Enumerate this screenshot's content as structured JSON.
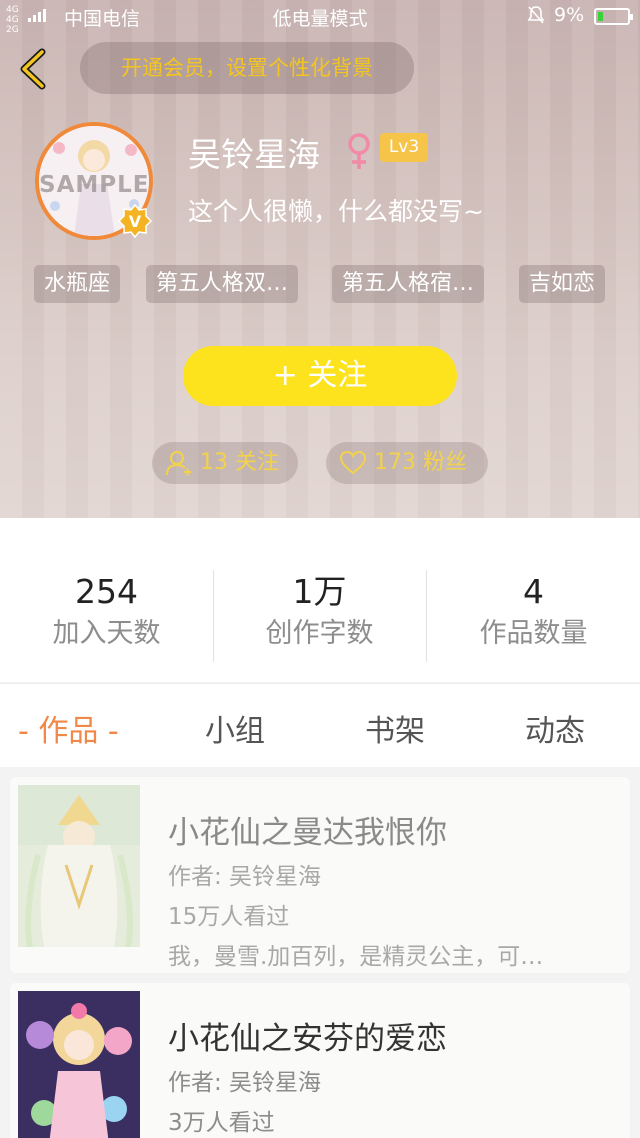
{
  "status_bar": {
    "network": "4G 4G 2G",
    "carrier": "中国电信",
    "mode": "低电量模式",
    "battery_percent": "9%",
    "battery_level": 0.09
  },
  "header": {
    "vip_promo": "开通会员，设置个性化背景"
  },
  "profile": {
    "avatar_watermark": "SAMPLE",
    "nickname": "吴铃星海",
    "gender": "♀",
    "level": "Lv3",
    "bio": "这个人很懒，什么都没写~",
    "tags": [
      "水瓶座",
      "第五人格双…",
      "第五人格宿…",
      "吉如恋"
    ],
    "follow_button": "+   关注",
    "following": "13 关注",
    "fans": "173 粉丝"
  },
  "stats": [
    {
      "value": "254",
      "label": "加入天数"
    },
    {
      "value": "1万",
      "label": "创作字数"
    },
    {
      "value": "4",
      "label": "作品数量"
    }
  ],
  "tabs": [
    {
      "label": "- 作品 -",
      "active": true
    },
    {
      "label": "小组",
      "active": false
    },
    {
      "label": "书架",
      "active": false
    },
    {
      "label": "动态",
      "active": false
    }
  ],
  "works": [
    {
      "title": "小花仙之曼达我恨你",
      "author": "作者: 吴铃星海",
      "views": "15万人看过",
      "desc": "我，曼雪.加百列，是精灵公主，可…"
    },
    {
      "title": "小花仙之安芬的爱恋",
      "author": "作者: 吴铃星海",
      "views": "3万人看过",
      "desc": ""
    }
  ],
  "colors": {
    "accent_orange": "#f0884a",
    "follow_yellow": "#fde21e",
    "vip_yellow": "#f4c520",
    "level_badge": "#f7c44a"
  },
  "icons": {
    "back": "chevron-left-icon",
    "bell": "bell-muted-icon",
    "following": "user-add-icon",
    "fans": "heart-icon",
    "gender": "female-icon",
    "vip": "vip-v-badge-icon"
  }
}
